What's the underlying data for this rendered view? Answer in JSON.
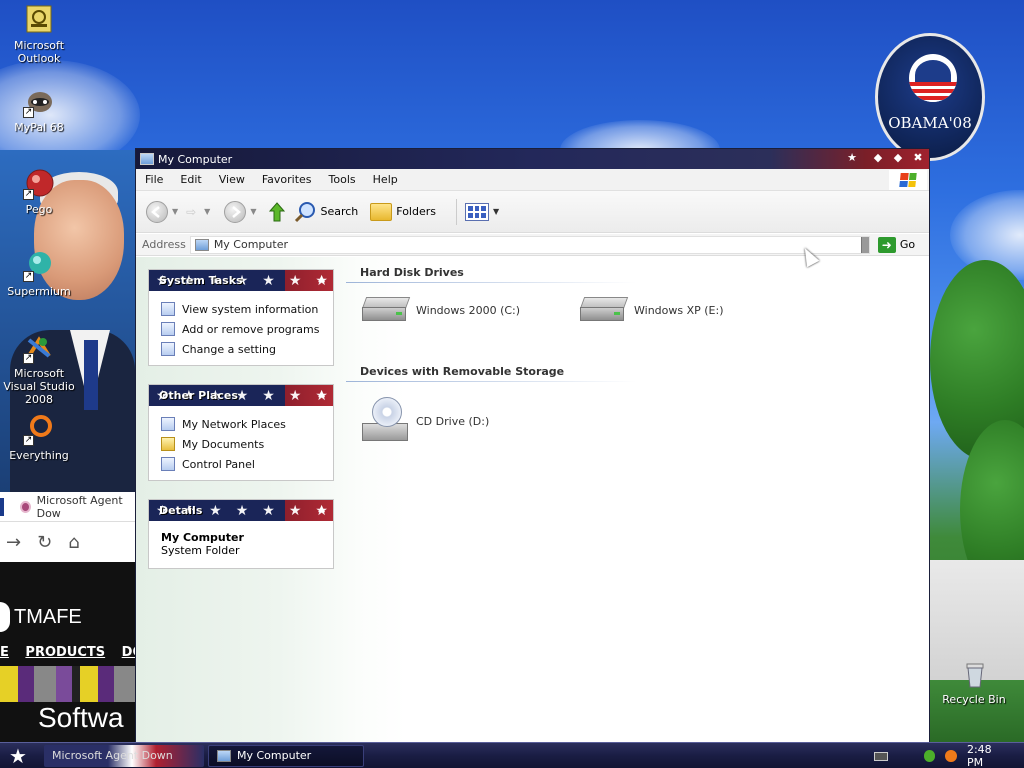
{
  "desktop": {
    "icons": [
      {
        "label": "Microsoft Outlook",
        "icon": "outlook-icon"
      },
      {
        "label": "MyPal 68",
        "icon": "mypal-icon"
      },
      {
        "label": "Pego",
        "icon": "pego-icon"
      },
      {
        "label": "Supermium",
        "icon": "supermium-icon"
      },
      {
        "label": "Microsoft Visual Studio 2008",
        "icon": "visual-studio-icon"
      },
      {
        "label": "Everything",
        "icon": "everything-icon"
      },
      {
        "label": "Recycle Bin",
        "icon": "recycle-bin-icon"
      }
    ],
    "wallpaper_logo_text": "OBAMA'08"
  },
  "background_browser": {
    "tab_title": "Microsoft Agent Dow",
    "site_brand": "TMAFE",
    "site_menu": [
      "E",
      "PRODUCTS",
      "DO"
    ],
    "site_big_text": "Softwa"
  },
  "window": {
    "title": "My Computer",
    "menu": [
      "File",
      "Edit",
      "View",
      "Favorites",
      "Tools",
      "Help"
    ],
    "toolbar": {
      "back_label": "Back",
      "forward_label": "Forward",
      "up_label": "Up",
      "search_label": "Search",
      "folders_label": "Folders",
      "views_label": "Views"
    },
    "address": {
      "label": "Address",
      "value": "My Computer",
      "go_label": "Go"
    },
    "panes": {
      "system_tasks": {
        "title": "System Tasks",
        "items": [
          "View system information",
          "Add or remove programs",
          "Change a setting"
        ]
      },
      "other_places": {
        "title": "Other Places",
        "items": [
          "My Network Places",
          "My Documents",
          "Control Panel"
        ]
      },
      "details": {
        "title": "Details",
        "name": "My Computer",
        "type": "System Folder"
      }
    },
    "groups": {
      "hard_disk": {
        "title": "Hard Disk Drives",
        "drives": [
          "Windows 2000 (C:)",
          "Windows XP (E:)"
        ]
      },
      "removable": {
        "title": "Devices with Removable Storage",
        "drives": [
          "CD Drive (D:)"
        ]
      }
    }
  },
  "taskbar": {
    "buttons": [
      "Microsoft Agent Down",
      "My Computer"
    ],
    "clock": "2:48 PM"
  },
  "colors": {
    "titlebar_blue": "#23285a",
    "titlebar_red": "#a0222e",
    "pane_header_blue": "#1a2558",
    "pane_header_red": "#b02a35",
    "taskbar": "#1a1d44"
  }
}
